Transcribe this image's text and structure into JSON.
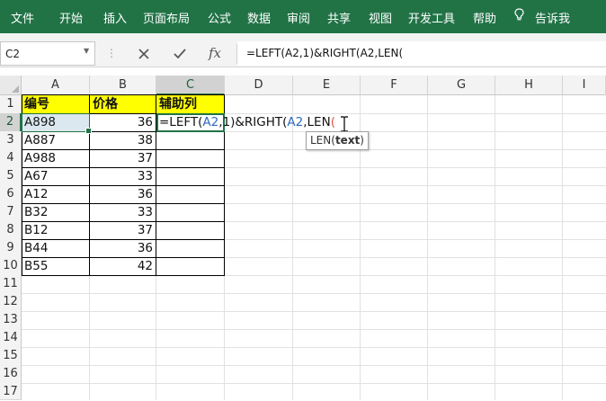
{
  "ribbon": {
    "tabs": [
      "文件",
      "开始",
      "插入",
      "页面布局",
      "公式",
      "数据",
      "审阅",
      "共享",
      "视图",
      "开发工具",
      "帮助"
    ],
    "tell_me": "告诉我",
    "bg_color": "#217346"
  },
  "formula_bar": {
    "name_box": "C2",
    "cancel_icon": "close-icon",
    "enter_icon": "check-icon",
    "fx_label": "fx",
    "content": "=LEFT(A2,1)&RIGHT(A2,LEN("
  },
  "columns": [
    "A",
    "B",
    "C",
    "D",
    "E",
    "F",
    "G",
    "H",
    "I"
  ],
  "rows": [
    "1",
    "2",
    "3",
    "4",
    "5",
    "6",
    "7",
    "8",
    "9",
    "10",
    "11",
    "12",
    "13",
    "14",
    "15",
    "16",
    "17"
  ],
  "active_cell": {
    "column": "C",
    "row": "2"
  },
  "table": {
    "headers": [
      "编号",
      "价格",
      "辅助列"
    ],
    "header_color": "#ffff00",
    "data": [
      {
        "code": "A898",
        "price": "36"
      },
      {
        "code": "A887",
        "price": "38"
      },
      {
        "code": "A988",
        "price": "37"
      },
      {
        "code": "A67",
        "price": "33"
      },
      {
        "code": "A12",
        "price": "36"
      },
      {
        "code": "B32",
        "price": "33"
      },
      {
        "code": "B12",
        "price": "37"
      },
      {
        "code": "B44",
        "price": "36"
      },
      {
        "code": "B55",
        "price": "42"
      }
    ]
  },
  "edit_cell": {
    "parts": [
      {
        "text": "=LEFT(",
        "kind": "plain"
      },
      {
        "text": "A2",
        "kind": "ref"
      },
      {
        "text": ",1)&RIGHT(",
        "kind": "plain"
      },
      {
        "text": "A2",
        "kind": "ref"
      },
      {
        "text": ",LEN",
        "kind": "plain"
      },
      {
        "text": "(",
        "kind": "paren"
      }
    ]
  },
  "tooltip": {
    "func": "LEN(",
    "arg": "text",
    "close": ")"
  }
}
